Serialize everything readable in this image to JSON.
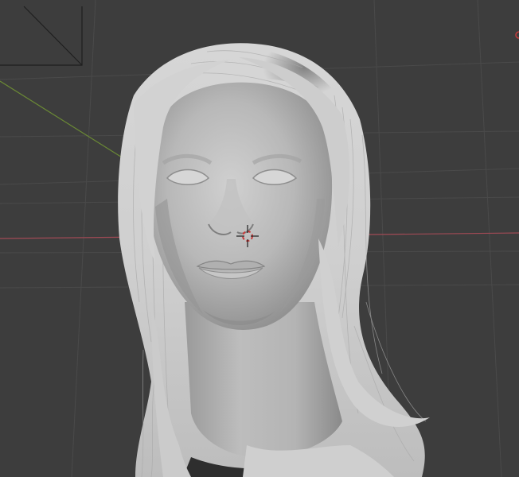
{
  "viewport": {
    "view": "3D Viewport",
    "shading": "solid",
    "background_color": "#3d3d3d",
    "grid_color": "#4a4a4a",
    "x_axis_color": "#a04a55",
    "y_axis_color": "#6b8a35"
  },
  "scene": {
    "objects": [
      {
        "name": "head",
        "type": "mesh",
        "color": "#b9b9b9"
      },
      {
        "name": "hair",
        "type": "hair-curves",
        "color": "#d4d4d4"
      }
    ],
    "camera_frame_visible": true,
    "gizmo_partial_visible": true
  },
  "cursor": {
    "icon": "3d-cursor-icon",
    "ring_color": "#c83c3c"
  }
}
